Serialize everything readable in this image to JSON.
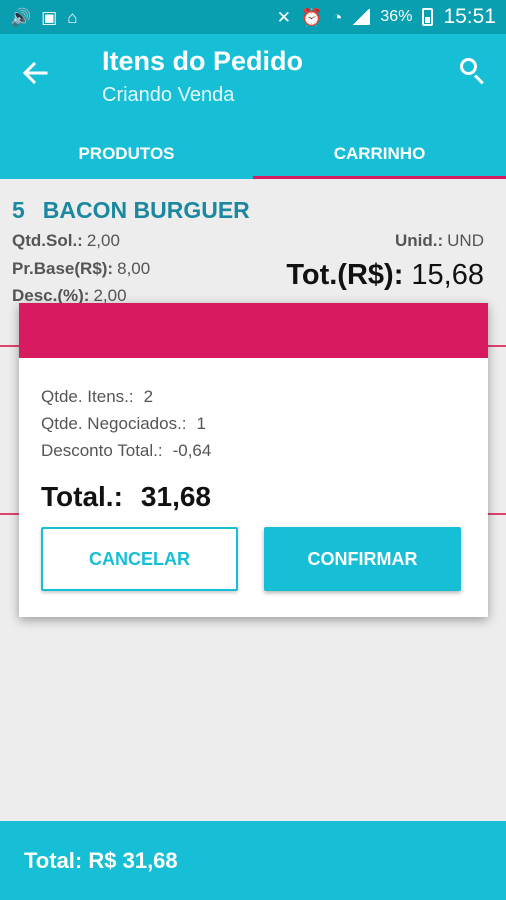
{
  "status_bar": {
    "left_icons": [
      "volume-icon",
      "image-icon",
      "incognito-icon"
    ],
    "right_icons": [
      "mute-icon",
      "alarm-icon",
      "wifi-icon",
      "signal-icon",
      "battery-icon"
    ],
    "battery_percent": "36%",
    "time": "15:51"
  },
  "app_bar": {
    "title": "Itens do Pedido",
    "subtitle": "Criando Venda"
  },
  "tabs": [
    {
      "label": "PRODUTOS",
      "active": false
    },
    {
      "label": "CARRINHO",
      "active": true
    }
  ],
  "items": [
    {
      "number": "5",
      "name": "BACON BURGUER",
      "qtd_label": "Qtd.Sol.:",
      "qtd_value": "2,00",
      "base_label": "Pr.Base(R$):",
      "base_value": "8,00",
      "desc_label": "Desc.(%):",
      "desc_value": "2,00",
      "unid_label": "Unid.:",
      "unid_value": "UND",
      "tot_label": "Tot.(R$):",
      "tot_value": "15,68"
    }
  ],
  "dialog": {
    "qtde_itens_label": "Qtde. Itens.:",
    "qtde_itens_value": "2",
    "qtde_negociados_label": "Qtde. Negociados.:",
    "qtde_negociados_value": "1",
    "desconto_label": "Desconto Total.:",
    "desconto_value": "-0,64",
    "total_label": "Total.:",
    "total_value": "31,68",
    "cancel_label": "CANCELAR",
    "confirm_label": "CONFIRMAR"
  },
  "bottom_bar": {
    "total_text": "Total: R$ 31,68"
  },
  "colors": {
    "primary": "#16bfd6",
    "status_bar": "#0a9fb0",
    "accent": "#d81b60",
    "item_title": "#1b88a0"
  }
}
